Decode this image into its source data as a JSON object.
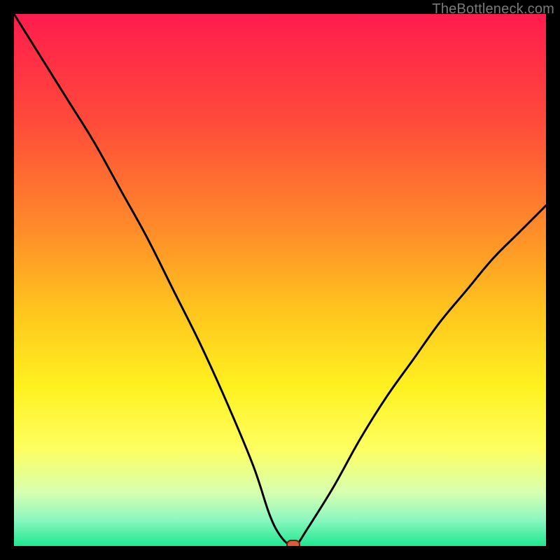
{
  "watermark": "TheBottleneck.com",
  "chart_data": {
    "type": "line",
    "title": "",
    "xlabel": "",
    "ylabel": "",
    "xlim": [
      0,
      100
    ],
    "ylim": [
      0,
      100
    ],
    "grid": false,
    "legend": false,
    "series": [
      {
        "name": "bottleneck-curve",
        "x": [
          0,
          5,
          10,
          15,
          20,
          25,
          30,
          35,
          40,
          45,
          48,
          50,
          52,
          53,
          55,
          60,
          65,
          70,
          75,
          80,
          85,
          90,
          95,
          100
        ],
        "y": [
          100,
          92,
          84,
          76,
          67,
          58,
          48,
          38,
          27,
          15,
          6,
          2,
          0,
          0,
          3,
          11,
          20,
          28,
          35,
          42,
          48,
          54,
          59,
          64
        ]
      }
    ],
    "marker": {
      "x": 52.5,
      "y": 0
    },
    "background_gradient": {
      "stops": [
        {
          "offset": 0.0,
          "color": "#ff1c4e"
        },
        {
          "offset": 0.2,
          "color": "#ff4a3a"
        },
        {
          "offset": 0.4,
          "color": "#ff8a2a"
        },
        {
          "offset": 0.55,
          "color": "#ffc21e"
        },
        {
          "offset": 0.7,
          "color": "#fff120"
        },
        {
          "offset": 0.82,
          "color": "#fdff63"
        },
        {
          "offset": 0.9,
          "color": "#d7ffb0"
        },
        {
          "offset": 0.95,
          "color": "#8cf7c0"
        },
        {
          "offset": 1.0,
          "color": "#1ee890"
        }
      ]
    },
    "colors": {
      "curve": "#000000",
      "marker_fill": "#e0593f",
      "marker_stroke": "#6e1d10",
      "frame": "#000000"
    }
  }
}
